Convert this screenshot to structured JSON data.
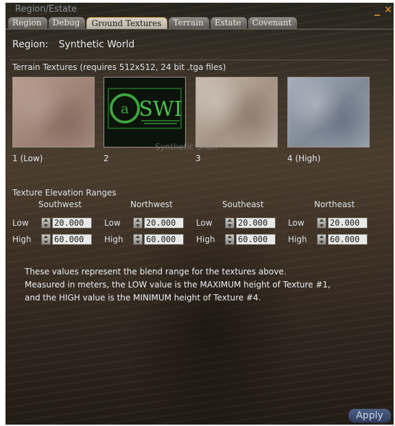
{
  "window": {
    "title": "Region/Estate",
    "minimize_symbol": "_",
    "close_symbol": "×",
    "accent_color": "#d39a3c"
  },
  "tabs": [
    {
      "label": "Region",
      "active": false
    },
    {
      "label": "Debug",
      "active": false
    },
    {
      "label": "Ground Textures",
      "active": true
    },
    {
      "label": "Terrain",
      "active": false
    },
    {
      "label": "Estate",
      "active": false
    },
    {
      "label": "Covenant",
      "active": false
    }
  ],
  "region": {
    "label": "Region:",
    "value": "Synthetic World"
  },
  "textures": {
    "caption": "Terrain Textures (requires 512x512, 24 bit .tga files)",
    "items": [
      {
        "label": "1 (Low)"
      },
      {
        "label": "2"
      },
      {
        "label": "3"
      },
      {
        "label": "4 (High)"
      }
    ],
    "logo_text": "SWI",
    "watermark": "Synthetic Shan"
  },
  "elevation": {
    "title": "Texture Elevation Ranges",
    "low_label": "Low",
    "high_label": "High",
    "columns": [
      {
        "name": "Southwest",
        "low": "20.000",
        "high": "60.000"
      },
      {
        "name": "Northwest",
        "low": "20.000",
        "high": "60.000"
      },
      {
        "name": "Southeast",
        "low": "20.000",
        "high": "60.000"
      },
      {
        "name": "Northeast",
        "low": "20.000",
        "high": "60.000"
      }
    ]
  },
  "note": {
    "line1": "These values represent the blend range for the textures above.",
    "line2": "Measured in meters, the LOW value is the MAXIMUM height of Texture #1,",
    "line3": "and the HIGH value is the MINIMUM height of Texture #4."
  },
  "apply_button": "Apply"
}
